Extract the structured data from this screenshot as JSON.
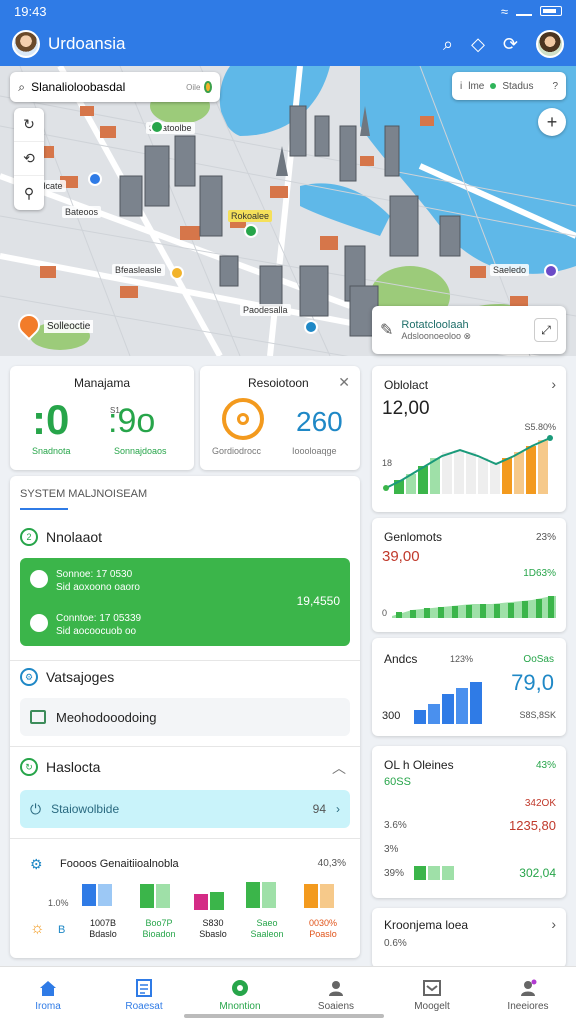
{
  "status": {
    "time": "19:43"
  },
  "app": {
    "title": "Urdoansia"
  },
  "search": {
    "value": "Slanalioloobasdal",
    "hint": "Oile"
  },
  "map": {
    "status_label": "Stadus",
    "status_prefix": "i",
    "status_mid": "lme",
    "label_bottom_left": "Solleoctie",
    "labels": [
      "Sigatoolbe",
      "Olecodcate",
      "Bateoos",
      "Bfeasleasle",
      "Rokoalee",
      "Paodesalla",
      "Saeledo"
    ],
    "location_card": {
      "title": "Rotatcloolaah",
      "subtitle": "Adsloonoeoloo ⊗"
    }
  },
  "card_mana": {
    "title": "Manajama",
    "big_value": ":0",
    "right_value": ":9o",
    "tiny": "S1",
    "left_label": "Snadnota",
    "right_label": "Sonnajdoaos"
  },
  "card_reso": {
    "title": "Resoiotoon",
    "value": "260",
    "left_label": "Gordiodrocc",
    "right_label": "Ioooloaqge"
  },
  "system": {
    "header": "SYSTEM MALJNOISEAM",
    "section1": {
      "title": "Nnolaaot",
      "icon_text": "2"
    },
    "green_rows": [
      {
        "line1": "Sonnoe: 17 0530",
        "line2": "Sid aoxoono oaoro"
      },
      {
        "line1": "Conntoe: 17 05339",
        "line2": "Sid aocoocuob oo"
      }
    ],
    "green_amount": "19,4550",
    "section2": {
      "title": "Vatsajoges"
    },
    "input_value": "Meohodooodoing",
    "section3": {
      "title": "Haslocta"
    },
    "cyan_row": {
      "label": "Staiowolbide",
      "count": "94"
    },
    "bars_title": "Foooos Genaitiioalnobla",
    "bars_pct": "40,3%",
    "bars_left_pct": "1.0%",
    "bar_groups": [
      {
        "label1": "1007B",
        "label2": "Bdaslo"
      },
      {
        "label1": "Boo7P",
        "label2": "Bioadon"
      },
      {
        "label1": "S830",
        "label2": "Sbaslo"
      },
      {
        "label1": "Saeo",
        "label2": "Saaleon"
      },
      {
        "label1": "0030%",
        "label2": "Poaslo"
      }
    ]
  },
  "right": {
    "c1": {
      "title": "Oblolact",
      "value": "12,00",
      "pct": "S5.80%",
      "axis": "18"
    },
    "c2": {
      "title": "Genlomots",
      "value": "39,00",
      "pct": "23%",
      "green": "1D63%",
      "zero": "0"
    },
    "c3": {
      "title": "Andcs",
      "pct": "123%",
      "green": "OoSas",
      "value": "79,0",
      "left": "300",
      "right": "S8S,8SK"
    },
    "c4": {
      "title": "OL h Oleines",
      "subtitle": "60SS",
      "rows": [
        {
          "l": "",
          "r": "43%"
        },
        {
          "l": "",
          "r": "342OK"
        },
        {
          "l": "3.6%",
          "r": "1235,80"
        },
        {
          "l": "3%",
          "r": ""
        },
        {
          "l": "39%",
          "r": "302,04"
        }
      ]
    },
    "c5": {
      "title": "Kroonjema loea",
      "value": "0.6%"
    }
  },
  "nav": [
    {
      "label": "Iroma"
    },
    {
      "label": "Roaesat"
    },
    {
      "label": "Mnontion"
    },
    {
      "label": "Soaiens"
    },
    {
      "label": "Moogelt"
    },
    {
      "label": "Ineeiores"
    }
  ],
  "colors": {
    "primary": "#2f7be6",
    "green": "#27a54a",
    "orange": "#f39a1e",
    "cyan": "#c9f3fa"
  }
}
